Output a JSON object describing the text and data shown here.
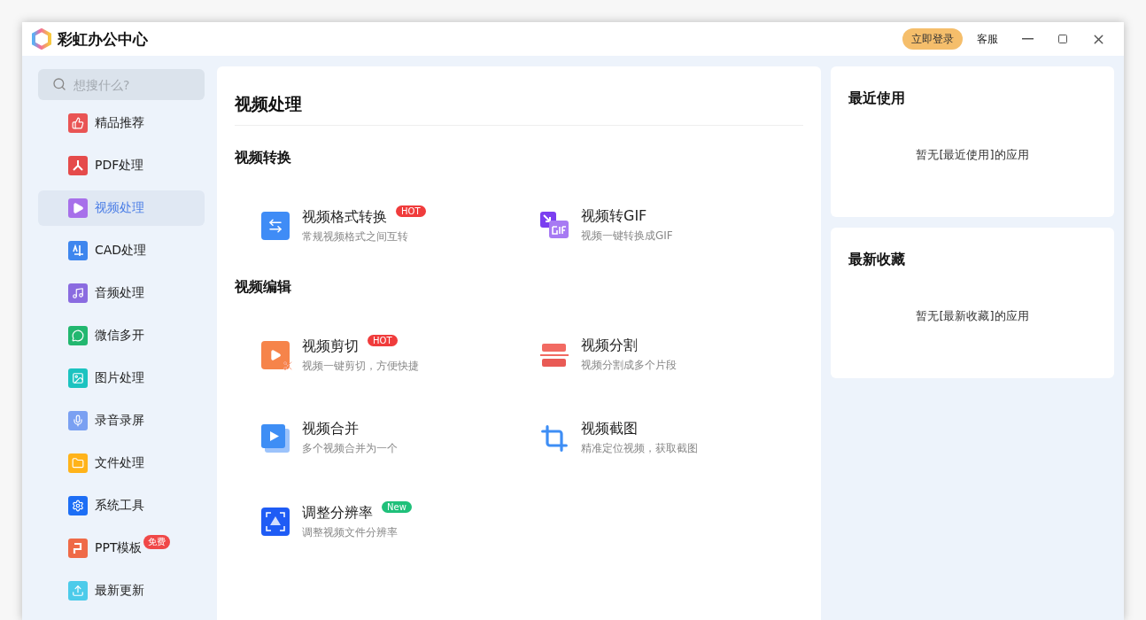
{
  "window": {
    "title": "彩虹办公中心",
    "login_button": "立即登录",
    "service_link": "客服"
  },
  "search": {
    "placeholder": "想搜什么?"
  },
  "sidebar": {
    "items": [
      {
        "label": "精品推荐",
        "selected": false
      },
      {
        "label": "PDF处理",
        "selected": false
      },
      {
        "label": "视频处理",
        "selected": true
      },
      {
        "label": "CAD处理",
        "selected": false
      },
      {
        "label": "音频处理",
        "selected": false
      },
      {
        "label": "微信多开",
        "selected": false
      },
      {
        "label": "图片处理",
        "selected": false
      },
      {
        "label": "录音录屏",
        "selected": false
      },
      {
        "label": "文件处理",
        "selected": false
      },
      {
        "label": "系统工具",
        "selected": false
      },
      {
        "label": "PPT模板",
        "selected": false,
        "badge": {
          "text": "免费",
          "color": "#f04848"
        }
      },
      {
        "label": "最新更新",
        "selected": false
      }
    ]
  },
  "main": {
    "title": "视频处理",
    "sections": [
      {
        "title": "视频转换",
        "tools": [
          {
            "name": "视频格式转换",
            "description": "常规视频格式之间互转",
            "badge": {
              "text": "HOT",
              "color": "#f03c3c"
            }
          },
          {
            "name": "视频转GIF",
            "description": "视频一键转换成GIF"
          }
        ]
      },
      {
        "title": "视频编辑",
        "tools": [
          {
            "name": "视频剪切",
            "description": "视频一键剪切，方便快捷",
            "badge": {
              "text": "HOT",
              "color": "#f03c3c"
            }
          },
          {
            "name": "视频分割",
            "description": "视频分割成多个片段"
          },
          {
            "name": "视频合并",
            "description": "多个视频合并为一个"
          },
          {
            "name": "视频截图",
            "description": "精准定位视频，获取截图"
          },
          {
            "name": "调整分辨率",
            "description": "调整视频文件分辨率",
            "badge": {
              "text": "New",
              "color": "#1fc07a"
            }
          }
        ]
      }
    ]
  },
  "recent": {
    "title": "最近使用",
    "empty_text": "暂无[最近使用]的应用"
  },
  "favorites": {
    "title": "最新收藏",
    "empty_text": "暂无[最新收藏]的应用"
  }
}
